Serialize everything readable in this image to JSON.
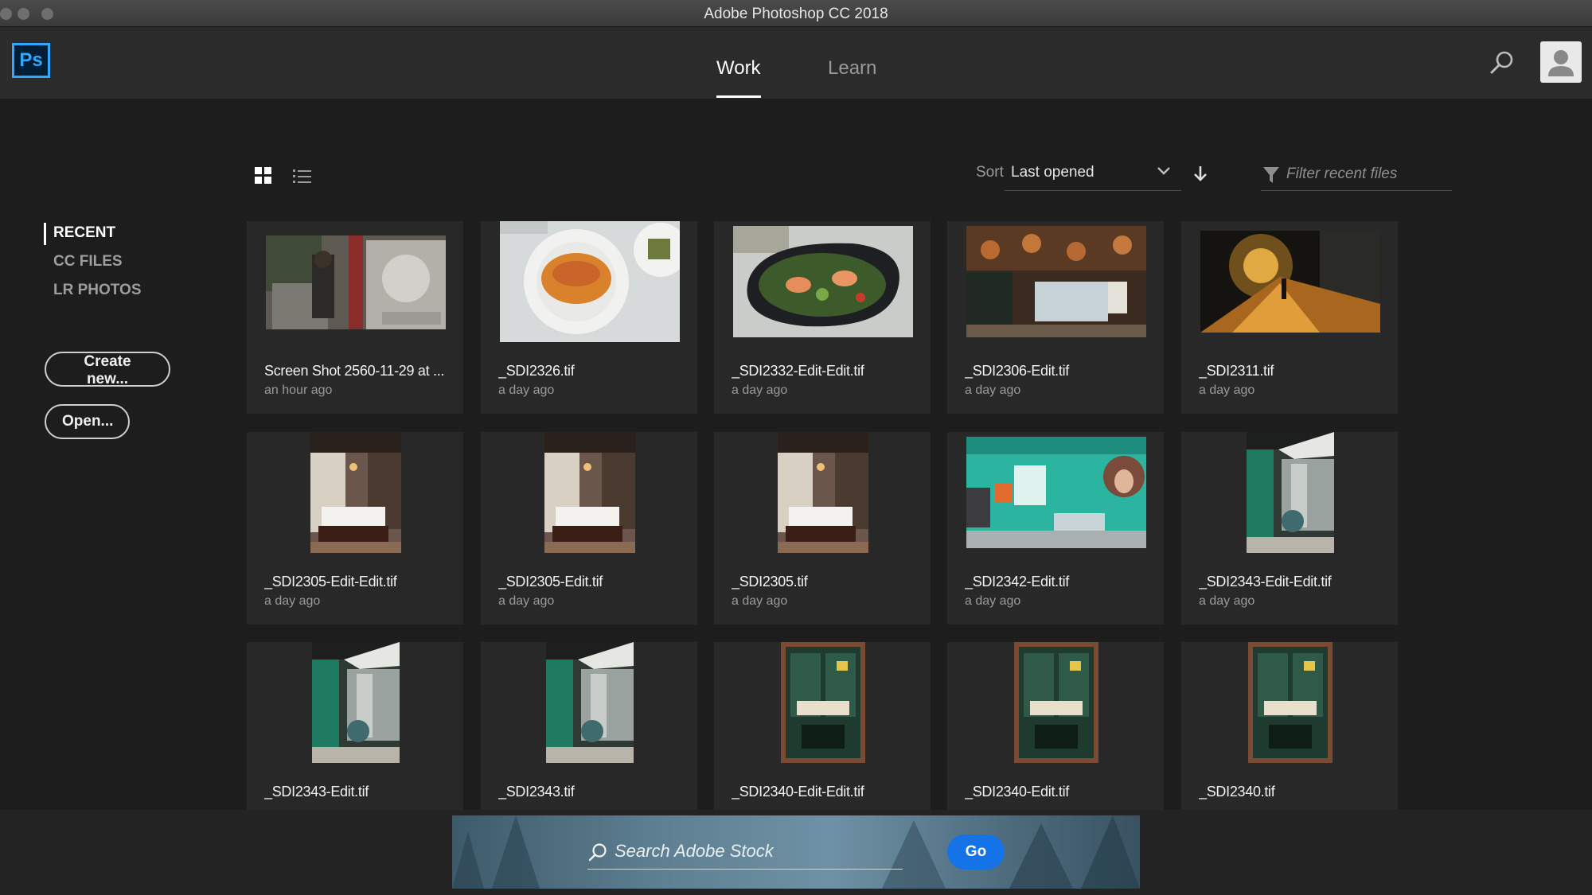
{
  "window": {
    "title": "Adobe Photoshop CC 2018"
  },
  "app": {
    "logo_text": "Ps",
    "tabs": [
      {
        "label": "Work",
        "active": true
      },
      {
        "label": "Learn",
        "active": false
      }
    ]
  },
  "sidebar": {
    "items": [
      {
        "label": "RECENT",
        "active": true
      },
      {
        "label": "CC FILES",
        "active": false
      },
      {
        "label": "LR PHOTOS",
        "active": false
      }
    ],
    "create_label": "Create new...",
    "open_label": "Open..."
  },
  "toolbar": {
    "sort_label": "Sort",
    "sort_value": "Last opened",
    "filter_placeholder": "Filter recent files"
  },
  "files": [
    {
      "name": "Screen Shot 2560-11-29 at ...",
      "time": "an hour ago"
    },
    {
      "name": "_SDI2326.tif",
      "time": "a day ago"
    },
    {
      "name": "_SDI2332-Edit-Edit.tif",
      "time": "a day ago"
    },
    {
      "name": "_SDI2306-Edit.tif",
      "time": "a day ago"
    },
    {
      "name": "_SDI2311.tif",
      "time": "a day ago"
    },
    {
      "name": "_SDI2305-Edit-Edit.tif",
      "time": "a day ago"
    },
    {
      "name": "_SDI2305-Edit.tif",
      "time": "a day ago"
    },
    {
      "name": "_SDI2305.tif",
      "time": "a day ago"
    },
    {
      "name": "_SDI2342-Edit.tif",
      "time": "a day ago"
    },
    {
      "name": "_SDI2343-Edit-Edit.tif",
      "time": "a day ago"
    },
    {
      "name": "_SDI2343-Edit.tif",
      "time": ""
    },
    {
      "name": "_SDI2343.tif",
      "time": ""
    },
    {
      "name": "_SDI2340-Edit-Edit.tif",
      "time": ""
    },
    {
      "name": "_SDI2340-Edit.tif",
      "time": ""
    },
    {
      "name": "_SDI2340.tif",
      "time": ""
    }
  ],
  "stock": {
    "placeholder": "Search Adobe Stock",
    "go_label": "Go"
  }
}
